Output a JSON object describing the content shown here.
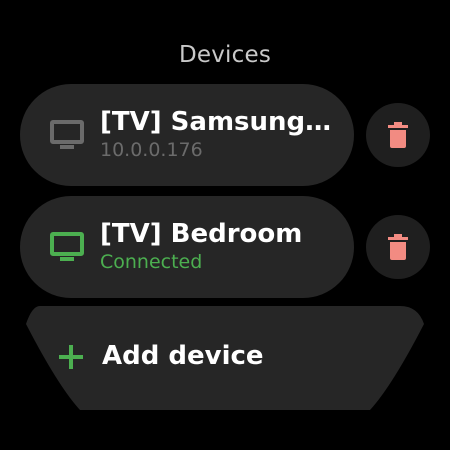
{
  "header": {
    "title": "Devices"
  },
  "devices": [
    {
      "label": "[TV] Samsung ...",
      "subtitle": "10.0.0.176",
      "icon": "tv-icon",
      "icon_color": "#6b6b6b",
      "status": "disconnected"
    },
    {
      "label": "[TV] Bedroom",
      "subtitle": "Connected",
      "icon": "tv-icon",
      "icon_color": "#4caf50",
      "status": "connected"
    }
  ],
  "actions": {
    "delete_icon": "trash-icon",
    "delete_color": "#f28b82",
    "add_device": {
      "label": "Add device",
      "icon": "plus-icon",
      "icon_color": "#4caf50"
    }
  }
}
